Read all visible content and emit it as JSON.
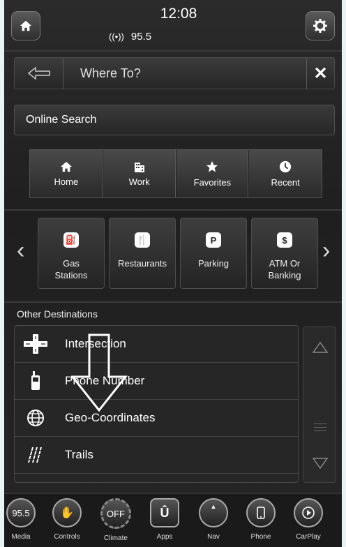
{
  "status": {
    "time": "12:08",
    "radio_icon": "radio-signal-icon",
    "station": "95.5"
  },
  "search": {
    "placeholder": "Where To?",
    "clear": "✕"
  },
  "online_search": "Online Search",
  "quick": [
    {
      "label": "Home",
      "icon": "home-icon"
    },
    {
      "label": "Work",
      "icon": "building-icon"
    },
    {
      "label": "Favorites",
      "icon": "star-icon"
    },
    {
      "label": "Recent",
      "icon": "clock-icon"
    }
  ],
  "poi": [
    {
      "label": "Gas Stations",
      "glyph": "⛽"
    },
    {
      "label": "Restaurants",
      "glyph": "🍴"
    },
    {
      "label": "Parking",
      "glyph": "P"
    },
    {
      "label": "ATM Or Banking",
      "glyph": "$"
    }
  ],
  "other_title": "Other Destinations",
  "other": [
    {
      "label": "Intersection",
      "icon": "intersection-icon"
    },
    {
      "label": "Phone Number",
      "icon": "phone-icon"
    },
    {
      "label": "Geo-Coordinates",
      "icon": "globe-icon"
    },
    {
      "label": "Trails",
      "icon": "trails-icon"
    }
  ],
  "dock": [
    {
      "label": "Media",
      "circle": "95.5"
    },
    {
      "label": "Controls",
      "circle": ""
    },
    {
      "label": "Climate",
      "circle": "OFF"
    },
    {
      "label": "Apps",
      "circle": ""
    },
    {
      "label": "Nav",
      "circle": ""
    },
    {
      "label": "Phone",
      "circle": ""
    },
    {
      "label": "CarPlay",
      "circle": ""
    }
  ]
}
